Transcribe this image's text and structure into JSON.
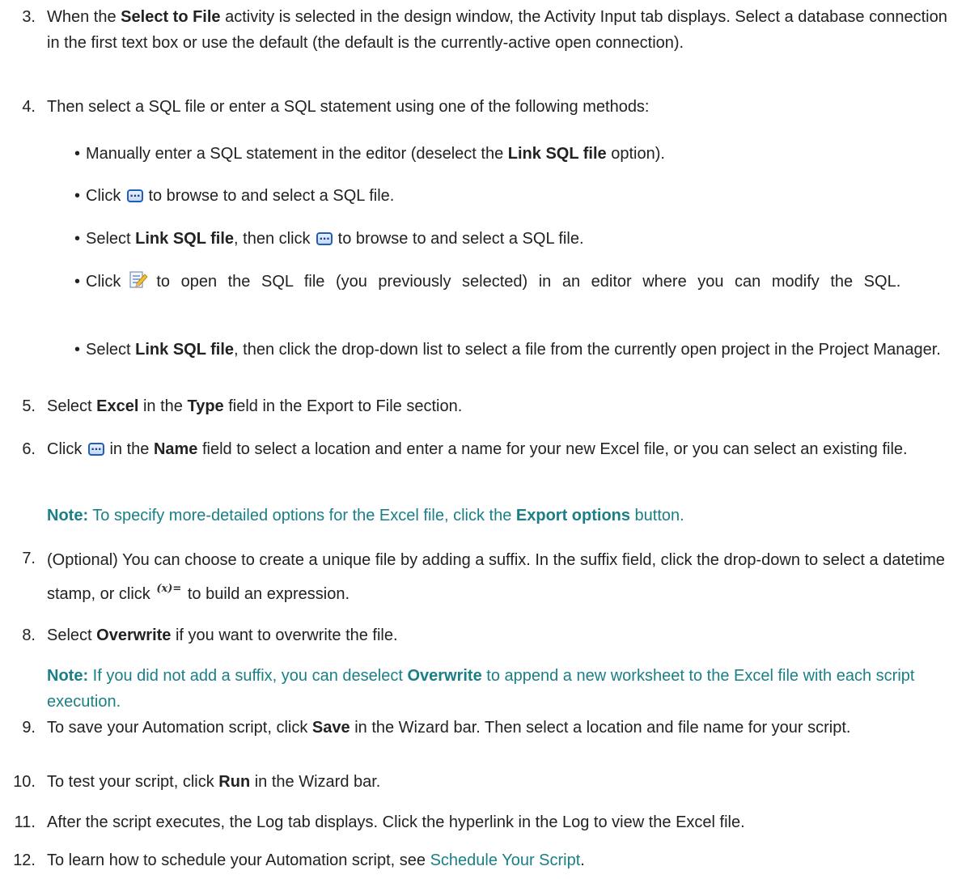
{
  "steps": {
    "s3": {
      "num": "3.",
      "t1": "When the ",
      "b1": "Select to File",
      "t2": " activity is selected in the design window, the Activity Input tab displays. Select a database connection in the first text box or use the default (the default is the currently-active open connection)."
    },
    "s4": {
      "num": "4.",
      "text": "Then select a SQL file or enter a SQL statement using one of the following methods:"
    },
    "b1": {
      "t1": "Manually enter a SQL statement in the editor (deselect the ",
      "b1": "Link SQL file",
      "t2": " option)."
    },
    "b2": {
      "t1": "Click ",
      "t2": " to browse to and select a SQL file."
    },
    "b3": {
      "t1": "Select ",
      "b1": "Link SQL file",
      "t2": ", then click ",
      "t3": " to browse to and select a SQL file."
    },
    "b4": {
      "t1": "Click",
      "t2": "to open the SQL file (you previously selected) in an editor where you can modify the SQL."
    },
    "b5": {
      "t1": "Select ",
      "b1": "Link SQL file",
      "t2": ", then click the drop-down list to select a file from the currently open project in the Project Manager."
    },
    "s5": {
      "num": "5.",
      "t1": "Select ",
      "b1": "Excel",
      "t2": " in the ",
      "b2": "Type",
      "t3": " field in the Export to File section."
    },
    "s6": {
      "num": "6.",
      "t1": "Click ",
      "t2": " in the ",
      "b1": "Name",
      "t3": " field to select a location and enter a name for your new Excel file, or you can select an existing file."
    },
    "n1": {
      "label": "Note:",
      "t1": " To specify more-detailed options for the Excel file, click the ",
      "b1": "Export options",
      "t2": " button."
    },
    "s7": {
      "num": "7.",
      "t1": "(Optional) You can choose to create a unique file by adding a suffix. In the suffix field, click the drop-down to select a datetime stamp, or click ",
      "icon": "(x)=",
      "t2": " to build an expression."
    },
    "s8": {
      "num": "8.",
      "t1": "Select ",
      "b1": "Overwrite",
      "t2": " if you want to overwrite the file."
    },
    "n2": {
      "label": "Note:",
      "t1": " If you did not add a suffix, you can deselect ",
      "b1": "Overwrite",
      "t2": " to append a new worksheet to the Excel file with each script execution."
    },
    "s9": {
      "num": "9.",
      "t1": "To save your Automation script, click ",
      "b1": "Save",
      "t2": " in the Wizard bar. Then select a location and file name for your script."
    },
    "s10": {
      "num": "10.",
      "t1": "To test your script, click ",
      "b1": "Run",
      "t2": " in the Wizard bar."
    },
    "s11": {
      "num": "11.",
      "text": "After the script executes, the Log tab displays. Click the hyperlink in the Log to view the Excel file."
    },
    "s12": {
      "num": "12.",
      "t1": "To learn how to schedule your Automation script, see ",
      "link": "Schedule Your Script",
      "t2": "."
    }
  },
  "icons": {
    "ellipsis": "ellipsis-button-icon",
    "edit": "edit-sql-icon",
    "expression": "expression-builder-icon"
  },
  "colors": {
    "note": "#1a7f86",
    "text": "#222222",
    "icon_blue": "#1f5fb8"
  }
}
